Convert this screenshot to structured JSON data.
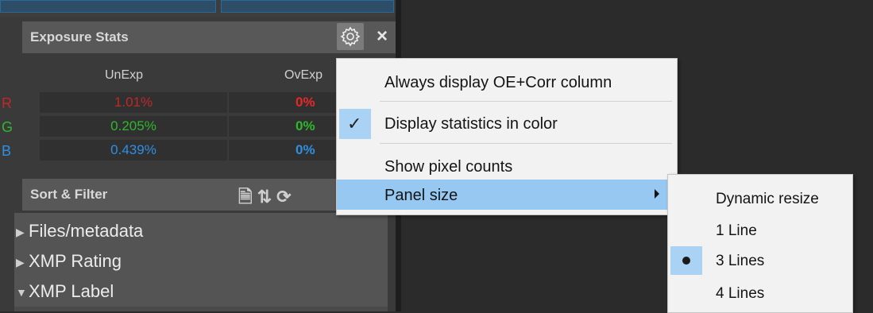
{
  "exposure_stats": {
    "title": "Exposure Stats",
    "close_icon": "×",
    "columns": [
      "UnExp",
      "OvExp"
    ],
    "rows": [
      {
        "channel": "R",
        "unexp": "1.01%",
        "ovexp": "0%",
        "color": "#c02828"
      },
      {
        "channel": "G",
        "unexp": "0.205%",
        "ovexp": "0%",
        "color": "#2eb82e"
      },
      {
        "channel": "B",
        "unexp": "0.439%",
        "ovexp": "0%",
        "color": "#2f8fe0"
      }
    ]
  },
  "sort_filter": {
    "title": "Sort & Filter",
    "icons": [
      "search-doc-icon",
      "sort-icon",
      "refresh-icon"
    ],
    "items": [
      {
        "label": "Files/metadata",
        "expanded": false
      },
      {
        "label": "XMP Rating",
        "expanded": false
      },
      {
        "label": "XMP Label",
        "expanded": true
      }
    ]
  },
  "context_menu": {
    "items": [
      {
        "label": "Always display OE+Corr column",
        "checked": false
      },
      {
        "label": "Display statistics in color",
        "checked": true
      },
      {
        "label": "Show pixel counts",
        "checked": false
      },
      {
        "label": "Panel size",
        "has_submenu": true,
        "highlighted": true
      }
    ]
  },
  "panel_size_submenu": {
    "items": [
      {
        "label": "Dynamic resize",
        "selected": false
      },
      {
        "label": "1 Line",
        "selected": false
      },
      {
        "label": "3 Lines",
        "selected": true
      },
      {
        "label": "4 Lines",
        "selected": false
      }
    ]
  },
  "colors": {
    "menu_highlight": "#96c8f2",
    "check_background": "#a9d2f5",
    "ovexp_text": "#e82828"
  }
}
